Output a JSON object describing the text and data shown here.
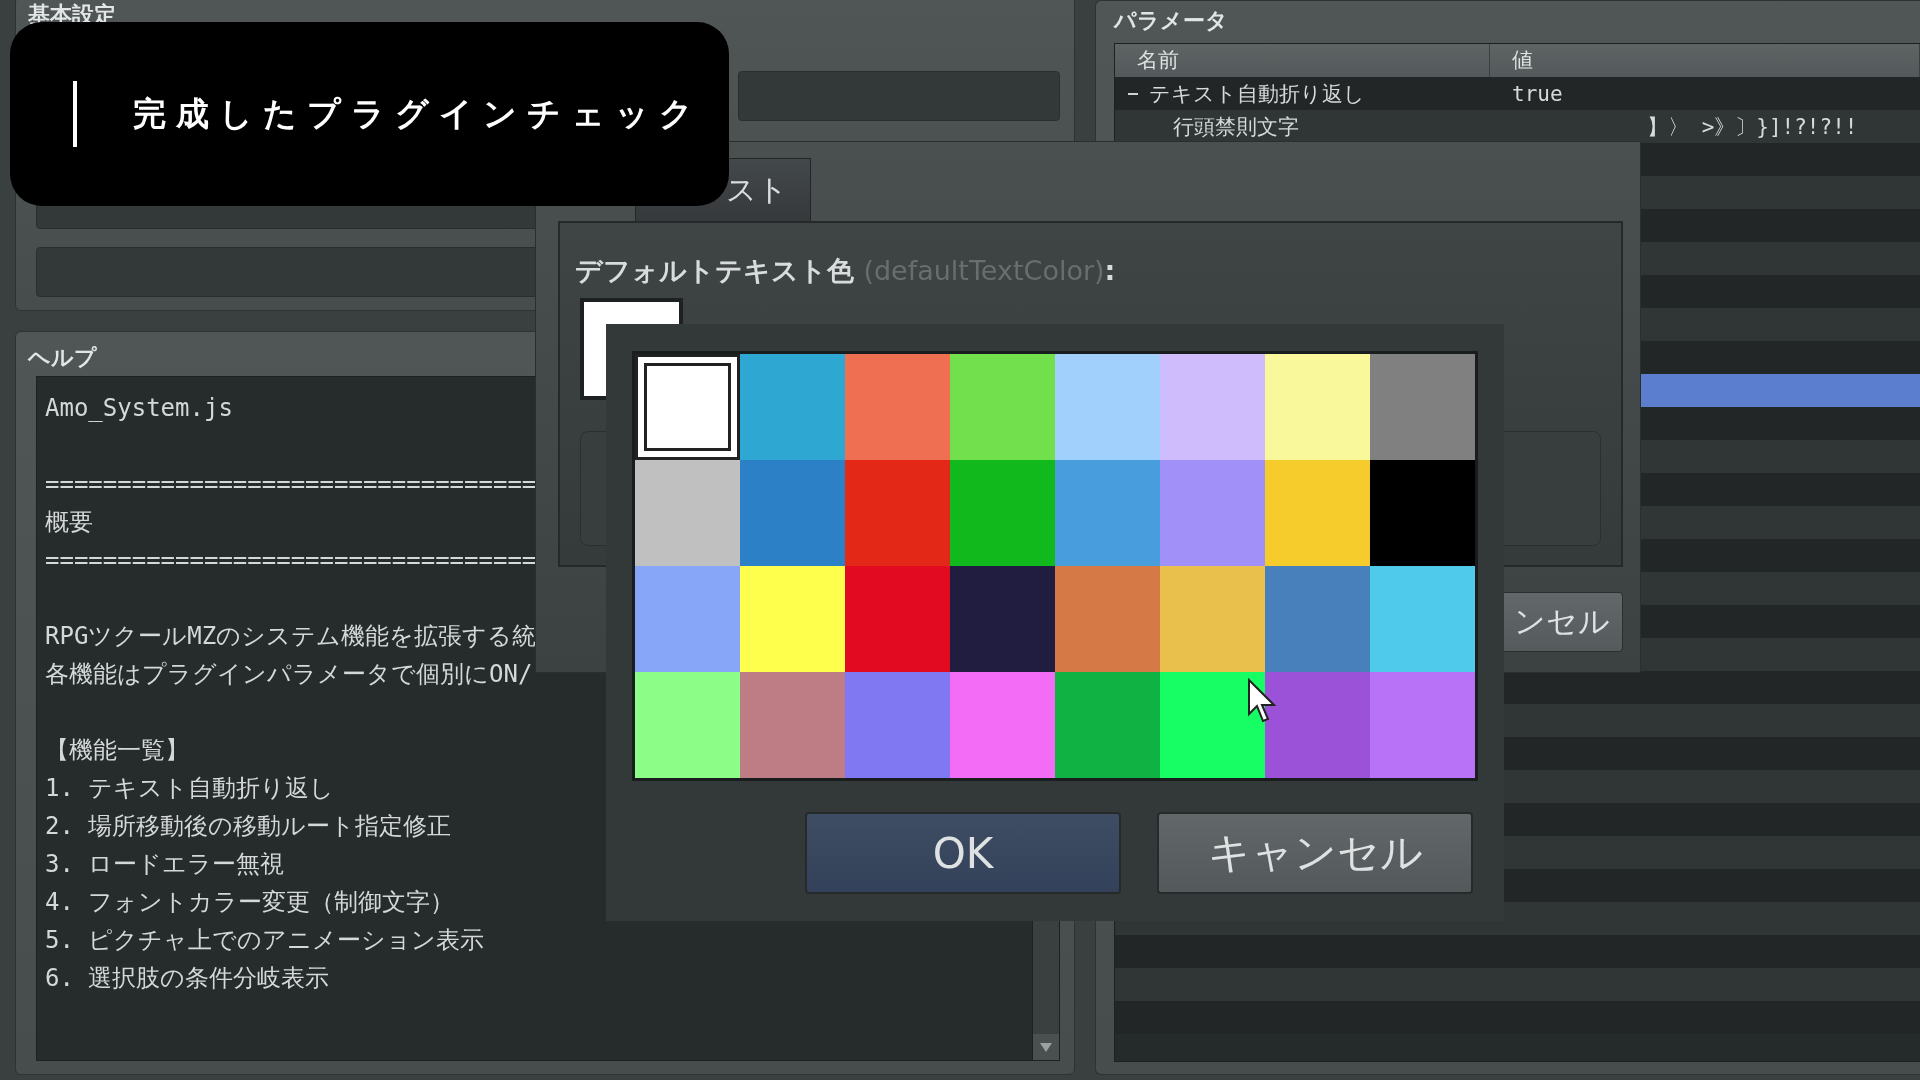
{
  "caption": {
    "title": "完成したプラグインチェック"
  },
  "basic_settings": {
    "title": "基本設定"
  },
  "help": {
    "title": "ヘルプ",
    "blocks": [
      {
        "lines": [
          "Amo_System.js"
        ]
      },
      {
        "lines": [
          "==================================",
          "概要",
          "=================================="
        ]
      },
      {
        "lines": [
          "RPGツクールMZのシステム機能を拡張する統",
          "各機能はプラグインパラメータで個別にON/"
        ]
      },
      {
        "lines": [
          "【機能一覧】",
          "1. テキスト自動折り返し",
          "2. 場所移動後の移動ルート指定修正",
          "3. ロードエラー無視",
          "4. フォントカラー変更（制御文字）",
          "5. ピクチャ上でのアニメーション表示",
          "6. 選択肢の条件分岐表示"
        ]
      }
    ]
  },
  "parameters": {
    "title": "パラメータ",
    "columns": [
      "名前",
      "値"
    ],
    "rows": [
      {
        "name": "テキスト自動折り返し",
        "value": "true",
        "expanded": true,
        "selected": false,
        "children": [
          {
            "name": "行頭禁則文字",
            "value": "】〉 >》〕}]!?!?!!",
            "selected": false
          }
        ]
      },
      {
        "selected": false
      },
      {
        "selected": false
      },
      {
        "selected": false
      },
      {
        "selected": false
      },
      {
        "selected": false
      },
      {
        "selected": false
      },
      {
        "selected": false
      },
      {
        "selected": true
      },
      {
        "selected": false
      },
      {
        "selected": false
      },
      {
        "selected": false
      },
      {
        "selected": false
      },
      {
        "selected": false
      },
      {
        "selected": false
      },
      {
        "selected": false
      },
      {
        "selected": false
      },
      {
        "selected": false
      },
      {
        "selected": false
      },
      {
        "selected": false
      },
      {
        "selected": false
      },
      {
        "selected": false
      },
      {
        "selected": false
      },
      {
        "selected": false
      },
      {
        "selected": false
      },
      {
        "selected": false
      },
      {
        "selected": false
      },
      {
        "selected": false
      }
    ]
  },
  "dialog": {
    "tabs": [
      {
        "label": "スト",
        "selected": true
      }
    ],
    "field": {
      "label": "デフォルトテキスト色",
      "hint": "(defaultTextColor)",
      "suffix": ":"
    },
    "button": "ンセル"
  },
  "palette": {
    "colors": [
      {
        "color": "#ffffff",
        "selected": true
      },
      {
        "color": "#2ea8d2",
        "selected": false
      },
      {
        "color": "#ee6f52",
        "selected": false
      },
      {
        "color": "#72e04c",
        "selected": false
      },
      {
        "color": "#a2d0fc",
        "selected": false
      },
      {
        "color": "#cfbcfc",
        "selected": false
      },
      {
        "color": "#f9f99c",
        "selected": false
      },
      {
        "color": "#808080",
        "selected": false
      },
      {
        "color": "#c0c0c0",
        "selected": false
      },
      {
        "color": "#2b80c6",
        "selected": false
      },
      {
        "color": "#e32817",
        "selected": false
      },
      {
        "color": "#12b91c",
        "selected": false
      },
      {
        "color": "#489ddc",
        "selected": false
      },
      {
        "color": "#a290f9",
        "selected": false
      },
      {
        "color": "#f6cc2d",
        "selected": false
      },
      {
        "color": "#000000",
        "selected": false
      },
      {
        "color": "#88a6f8",
        "selected": false
      },
      {
        "color": "#fefe4c",
        "selected": false
      },
      {
        "color": "#e20a21",
        "selected": false
      },
      {
        "color": "#201d40",
        "selected": false
      },
      {
        "color": "#d57a47",
        "selected": false
      },
      {
        "color": "#e9c04c",
        "selected": false
      },
      {
        "color": "#4780bb",
        "selected": false
      },
      {
        "color": "#4fcaea",
        "selected": false
      },
      {
        "color": "#8cfd86",
        "selected": false
      },
      {
        "color": "#be7d84",
        "selected": false
      },
      {
        "color": "#8078f3",
        "selected": false
      },
      {
        "color": "#f26cf6",
        "selected": false
      },
      {
        "color": "#10b343",
        "selected": false
      },
      {
        "color": "#17fd64",
        "selected": false
      },
      {
        "color": "#9b51d8",
        "selected": false
      },
      {
        "color": "#b872f7",
        "selected": false
      }
    ],
    "buttons": [
      {
        "label": "OK",
        "kind": "ok"
      },
      {
        "label": "キャンセル",
        "kind": "cancel"
      }
    ]
  }
}
